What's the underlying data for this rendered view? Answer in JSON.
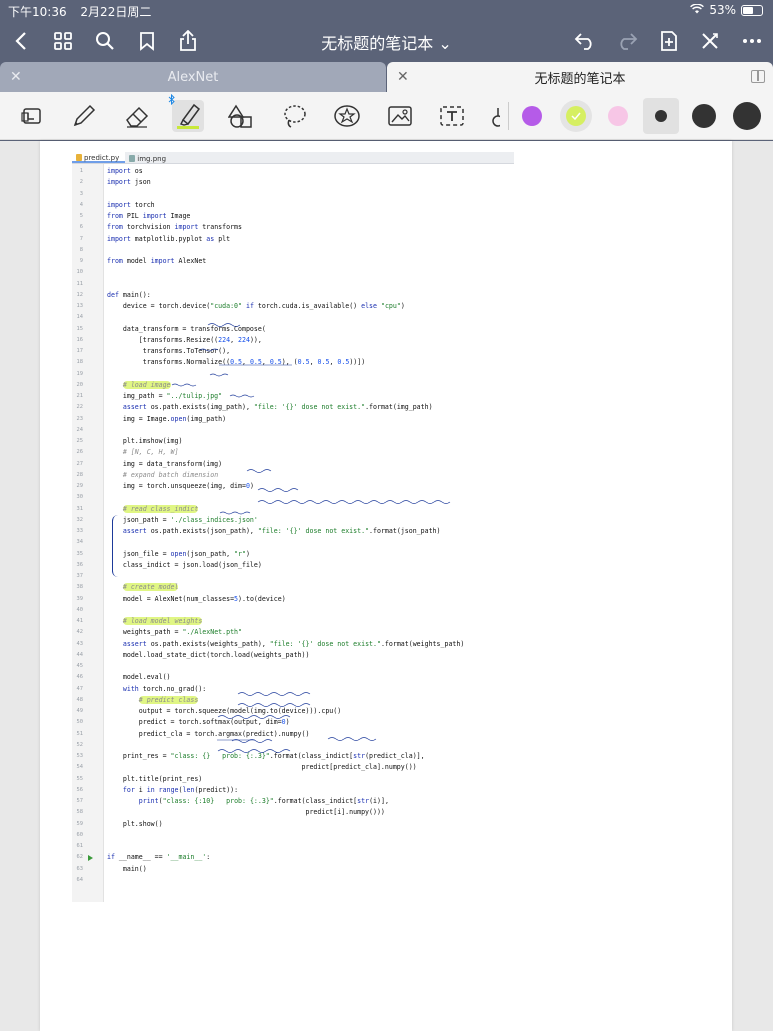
{
  "status_bar": {
    "time": "下午10:36",
    "date": "2月22日周二",
    "battery": "53%"
  },
  "nav": {
    "title": "无标题的笔记本",
    "title_chevron": "⌄"
  },
  "tabs": [
    {
      "label": "AlexNet",
      "active": false
    },
    {
      "label": "无标题的笔记本",
      "active": true
    }
  ],
  "toolbar": {
    "tools": [
      "lasso-select",
      "pen",
      "eraser",
      "highlighter",
      "shapes",
      "lasso",
      "sticker",
      "image",
      "text",
      "laser"
    ],
    "selected_tool": "highlighter",
    "colors": [
      "#b55be8",
      "#d6ef61",
      "#f7c6e6"
    ],
    "selected_color": "#d6ef61",
    "stroke_sizes": [
      "small",
      "medium",
      "large"
    ],
    "selected_size": "small"
  },
  "ide": {
    "tabs": [
      {
        "label": "predict.py",
        "active": true
      },
      {
        "label": "img.png",
        "active": false
      }
    ],
    "run_line": 62,
    "code": [
      {
        "n": "1",
        "t": "import os"
      },
      {
        "n": "2",
        "t": "import json"
      },
      {
        "n": "3",
        "t": ""
      },
      {
        "n": "4",
        "t": "import torch"
      },
      {
        "n": "5",
        "t": "from PIL import Image"
      },
      {
        "n": "6",
        "t": "from torchvision import transforms"
      },
      {
        "n": "7",
        "t": "import matplotlib.pyplot as plt"
      },
      {
        "n": "8",
        "t": ""
      },
      {
        "n": "9",
        "t": "from model import AlexNet"
      },
      {
        "n": "10",
        "t": ""
      },
      {
        "n": "11",
        "t": ""
      },
      {
        "n": "12",
        "t": "def main():"
      },
      {
        "n": "13",
        "t": "    device = torch.device(\"cuda:0\" if torch.cuda.is_available() else \"cpu\")"
      },
      {
        "n": "14",
        "t": ""
      },
      {
        "n": "15",
        "t": "    data_transform = transforms.Compose("
      },
      {
        "n": "16",
        "t": "        [transforms.Resize((224, 224)),"
      },
      {
        "n": "17",
        "t": "         transforms.ToTensor(),"
      },
      {
        "n": "18",
        "t": "         transforms.Normalize((0.5, 0.5, 0.5), (0.5, 0.5, 0.5))])"
      },
      {
        "n": "19",
        "t": ""
      },
      {
        "n": "20",
        "t": "    # load image"
      },
      {
        "n": "21",
        "t": "    img_path = \"../tulip.jpg\""
      },
      {
        "n": "22",
        "t": "    assert os.path.exists(img_path), \"file: '{}' dose not exist.\".format(img_path)"
      },
      {
        "n": "23",
        "t": "    img = Image.open(img_path)"
      },
      {
        "n": "24",
        "t": ""
      },
      {
        "n": "25",
        "t": "    plt.imshow(img)"
      },
      {
        "n": "26",
        "t": "    # [N, C, H, W]"
      },
      {
        "n": "27",
        "t": "    img = data_transform(img)"
      },
      {
        "n": "28",
        "t": "    # expand batch dimension"
      },
      {
        "n": "29",
        "t": "    img = torch.unsqueeze(img, dim=0)"
      },
      {
        "n": "30",
        "t": ""
      },
      {
        "n": "31",
        "t": "    # read class_indict"
      },
      {
        "n": "32",
        "t": "    json_path = './class_indices.json'"
      },
      {
        "n": "33",
        "t": "    assert os.path.exists(json_path), \"file: '{}' dose not exist.\".format(json_path)"
      },
      {
        "n": "34",
        "t": ""
      },
      {
        "n": "35",
        "t": "    json_file = open(json_path, \"r\")"
      },
      {
        "n": "36",
        "t": "    class_indict = json.load(json_file)"
      },
      {
        "n": "37",
        "t": ""
      },
      {
        "n": "38",
        "t": "    # create model"
      },
      {
        "n": "39",
        "t": "    model = AlexNet(num_classes=5).to(device)"
      },
      {
        "n": "40",
        "t": ""
      },
      {
        "n": "41",
        "t": "    # load model weights"
      },
      {
        "n": "42",
        "t": "    weights_path = \"./AlexNet.pth\""
      },
      {
        "n": "43",
        "t": "    assert os.path.exists(weights_path), \"file: '{}' dose not exist.\".format(weights_path)"
      },
      {
        "n": "44",
        "t": "    model.load_state_dict(torch.load(weights_path))"
      },
      {
        "n": "45",
        "t": ""
      },
      {
        "n": "46",
        "t": "    model.eval()"
      },
      {
        "n": "47",
        "t": "    with torch.no_grad():"
      },
      {
        "n": "48",
        "t": "        # predict class"
      },
      {
        "n": "49",
        "t": "        output = torch.squeeze(model(img.to(device))).cpu()"
      },
      {
        "n": "50",
        "t": "        predict = torch.softmax(output, dim=0)"
      },
      {
        "n": "51",
        "t": "        predict_cla = torch.argmax(predict).numpy()"
      },
      {
        "n": "52",
        "t": ""
      },
      {
        "n": "53",
        "t": "    print_res = \"class: {}   prob: {:.3}\".format(class_indict[str(predict_cla)],"
      },
      {
        "n": "54",
        "t": "                                                 predict[predict_cla].numpy())"
      },
      {
        "n": "55",
        "t": "    plt.title(print_res)"
      },
      {
        "n": "56",
        "t": "    for i in range(len(predict)):"
      },
      {
        "n": "57",
        "t": "        print(\"class: {:10}   prob: {:.3}\".format(class_indict[str(i)],"
      },
      {
        "n": "58",
        "t": "                                                  predict[i].numpy()))"
      },
      {
        "n": "59",
        "t": "    plt.show()"
      },
      {
        "n": "60",
        "t": ""
      },
      {
        "n": "61",
        "t": ""
      },
      {
        "n": "62",
        "t": "if __name__ == '__main__':"
      },
      {
        "n": "63",
        "t": "    main()"
      },
      {
        "n": "64",
        "t": ""
      }
    ],
    "highlighted_lines": [
      20,
      31,
      38,
      41,
      48
    ]
  }
}
